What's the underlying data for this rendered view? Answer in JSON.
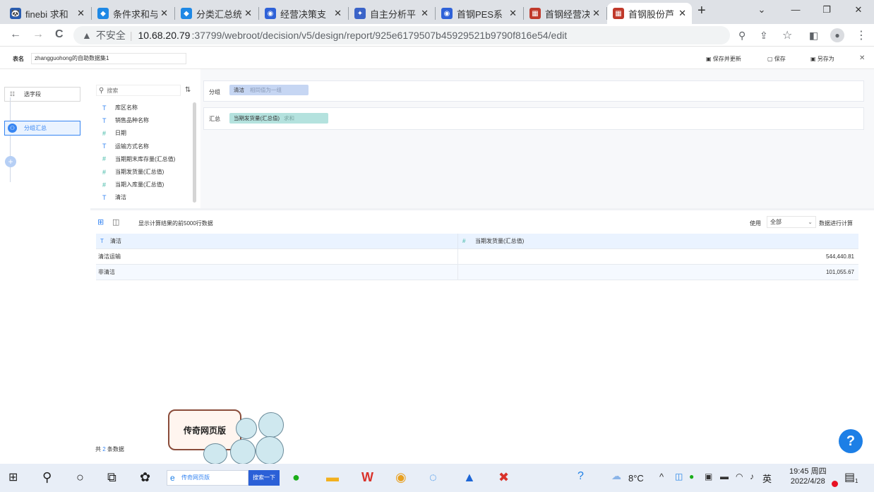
{
  "browser": {
    "tabs": [
      {
        "title": "finebi 求和",
        "icon": "🐼",
        "color": "#2a5db0"
      },
      {
        "title": "条件求和与",
        "icon": "◆",
        "color": "#1e88e5"
      },
      {
        "title": "分类汇总统",
        "icon": "◆",
        "color": "#1e88e5"
      },
      {
        "title": "经营决策支",
        "icon": "◉",
        "color": "#2f62d8"
      },
      {
        "title": "自主分析平",
        "icon": "✦",
        "color": "#3a63c8"
      },
      {
        "title": "首钢PES系",
        "icon": "◉",
        "color": "#2f62d8"
      },
      {
        "title": "首钢经营决",
        "icon": "▦",
        "color": "#c0392b"
      },
      {
        "title": "首钢股份芦",
        "icon": "▦",
        "color": "#c0392b"
      }
    ],
    "close_glyph": "✕",
    "new_tab": "+",
    "url": {
      "warning": "▲",
      "insecure": "不安全",
      "host": "10.68.20.79",
      "path": ":37799/webroot/decision/v5/design/report/925e6179507b45929521b9790f816e54/edit"
    },
    "nav": {
      "back": "←",
      "forward": "→",
      "reload": "C"
    },
    "addr_icons": {
      "zoom": "⚲",
      "share": "⇪",
      "star": "☆",
      "sidepanel": "◧",
      "profile": "●",
      "menu": "⋮"
    },
    "win": {
      "down": "⌄",
      "minimize": "—",
      "restore": "❐",
      "close": "✕"
    }
  },
  "header": {
    "label": "表名",
    "dataset_name": "zhangguohong的自助数据集1",
    "buttons": {
      "save_update": "保存并更新",
      "save": "保存",
      "save_as": "另存为"
    },
    "close": "✕"
  },
  "steps": [
    {
      "label": "选字段",
      "icon": "☷"
    },
    {
      "label": "分组汇总",
      "icon": "⚇"
    }
  ],
  "add_step": "+",
  "fields": {
    "search_placeholder": "搜索",
    "items": [
      {
        "type": "T",
        "name": "库区名称"
      },
      {
        "type": "T",
        "name": "销售品种名称"
      },
      {
        "type": "#",
        "name": "日期"
      },
      {
        "type": "T",
        "name": "运输方式名称"
      },
      {
        "type": "#",
        "name": "当期期末库存量(汇总值)"
      },
      {
        "type": "#",
        "name": "当期发货量(汇总值)"
      },
      {
        "type": "#",
        "name": "当期入库量(汇总值)"
      },
      {
        "type": "T",
        "name": "清洁"
      }
    ]
  },
  "group": {
    "label": "分组",
    "chip_name": "清洁",
    "chip_desc": "相同值为一组"
  },
  "summary": {
    "label": "汇总",
    "chip_name": "当期发货量(汇总值)",
    "chip_desc": "求和"
  },
  "preview": {
    "info": "显示计算结果的前5000行数据",
    "use_label": "使用",
    "use_value": "全部",
    "use_suffix": "数据进行计算",
    "columns": [
      {
        "type": "T",
        "name": "清洁"
      },
      {
        "type": "#",
        "name": "当期发货量(汇总值)"
      }
    ],
    "rows": [
      [
        "清洁运输",
        "544,440.81"
      ],
      [
        "非清洁",
        "101,055.67"
      ]
    ],
    "total_prefix": "共",
    "total_count": "2",
    "total_suffix": "条数据"
  },
  "popup": {
    "text": "传奇网页版"
  },
  "help": "?",
  "taskbar": {
    "search_box": "传奇网页版",
    "search_btn": "搜索一下",
    "temp": "8°C",
    "ime": "英",
    "time": "19:45 周四",
    "date": "2022/4/28",
    "badge": "1"
  }
}
